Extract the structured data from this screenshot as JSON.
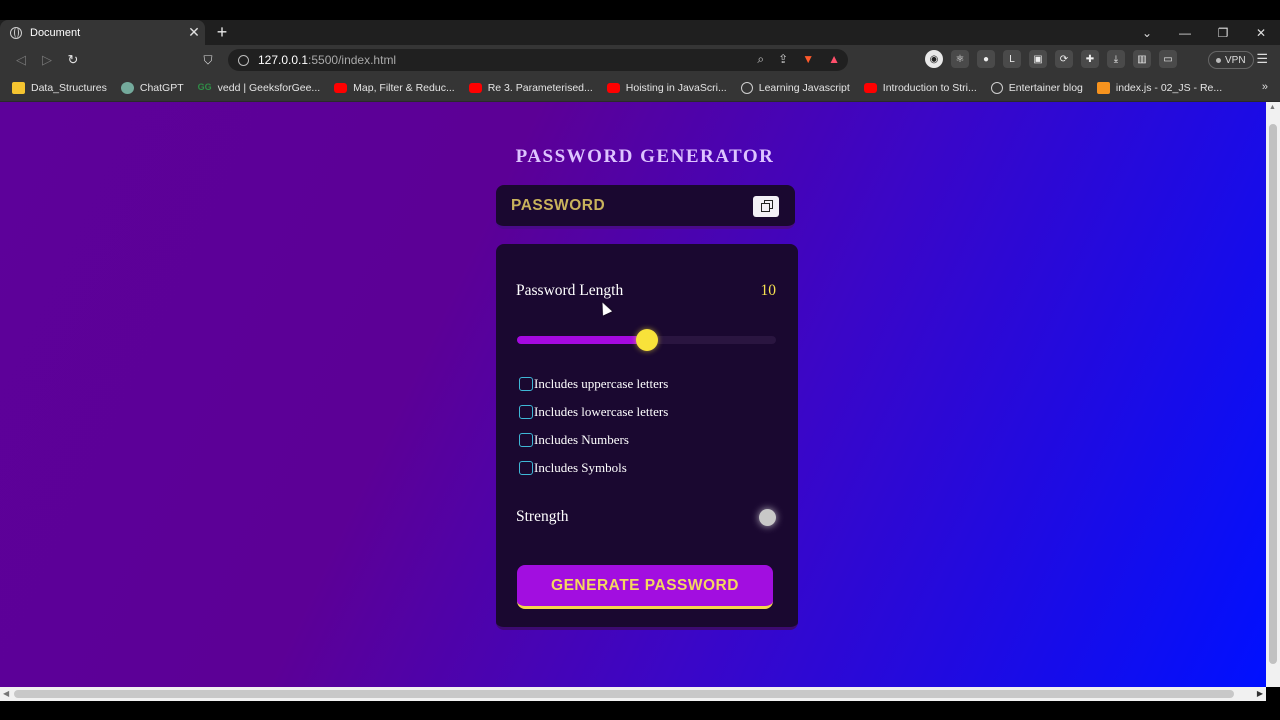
{
  "browser": {
    "tab_title": "Document",
    "tab_close": "✕",
    "new_tab": "+",
    "url_host": "127.0.0.1",
    "url_rest": ":5500/index.html",
    "vpn_label": "VPN",
    "bookmarks": [
      {
        "label": "Data_Structures",
        "icon": "folder-icon"
      },
      {
        "label": "ChatGPT",
        "icon": "chatgpt-icon"
      },
      {
        "label": "vedd | GeeksforGee...",
        "icon": "gfg-icon"
      },
      {
        "label": "Map, Filter & Reduc...",
        "icon": "youtube-icon"
      },
      {
        "label": "Re 3. Parameterised...",
        "icon": "youtube-icon"
      },
      {
        "label": "Hoisting in JavaScri...",
        "icon": "youtube-icon"
      },
      {
        "label": "Learning Javascript",
        "icon": "globe-icon"
      },
      {
        "label": "Introduction to Stri...",
        "icon": "youtube-icon"
      },
      {
        "label": "Entertainer blog",
        "icon": "globe-icon"
      },
      {
        "label": "index.js - 02_JS - Re...",
        "icon": "js-icon"
      }
    ]
  },
  "app": {
    "title": "PASSWORD GENERATOR",
    "password_display": "PASSWORD",
    "length_label": "Password Length",
    "length_value": "10",
    "slider": {
      "min": 0,
      "max": 20,
      "value": 10,
      "fill_color": "#a509e0",
      "knob_color": "#f8e23a"
    },
    "options": [
      {
        "label": "Includes uppercase letters",
        "checked": false
      },
      {
        "label": "Includes lowercase letters",
        "checked": false
      },
      {
        "label": "Includes Numbers",
        "checked": false
      },
      {
        "label": "Includes Symbols",
        "checked": false
      }
    ],
    "strength_label": "Strength",
    "strength_color": "#c8c8c8",
    "generate_label": "GENERATE PASSWORD"
  },
  "colors": {
    "title": "#ddc4ff",
    "accent_yellow": "#f5e050",
    "button_purple": "#a20ee0",
    "card_bg": "#1a0830"
  }
}
